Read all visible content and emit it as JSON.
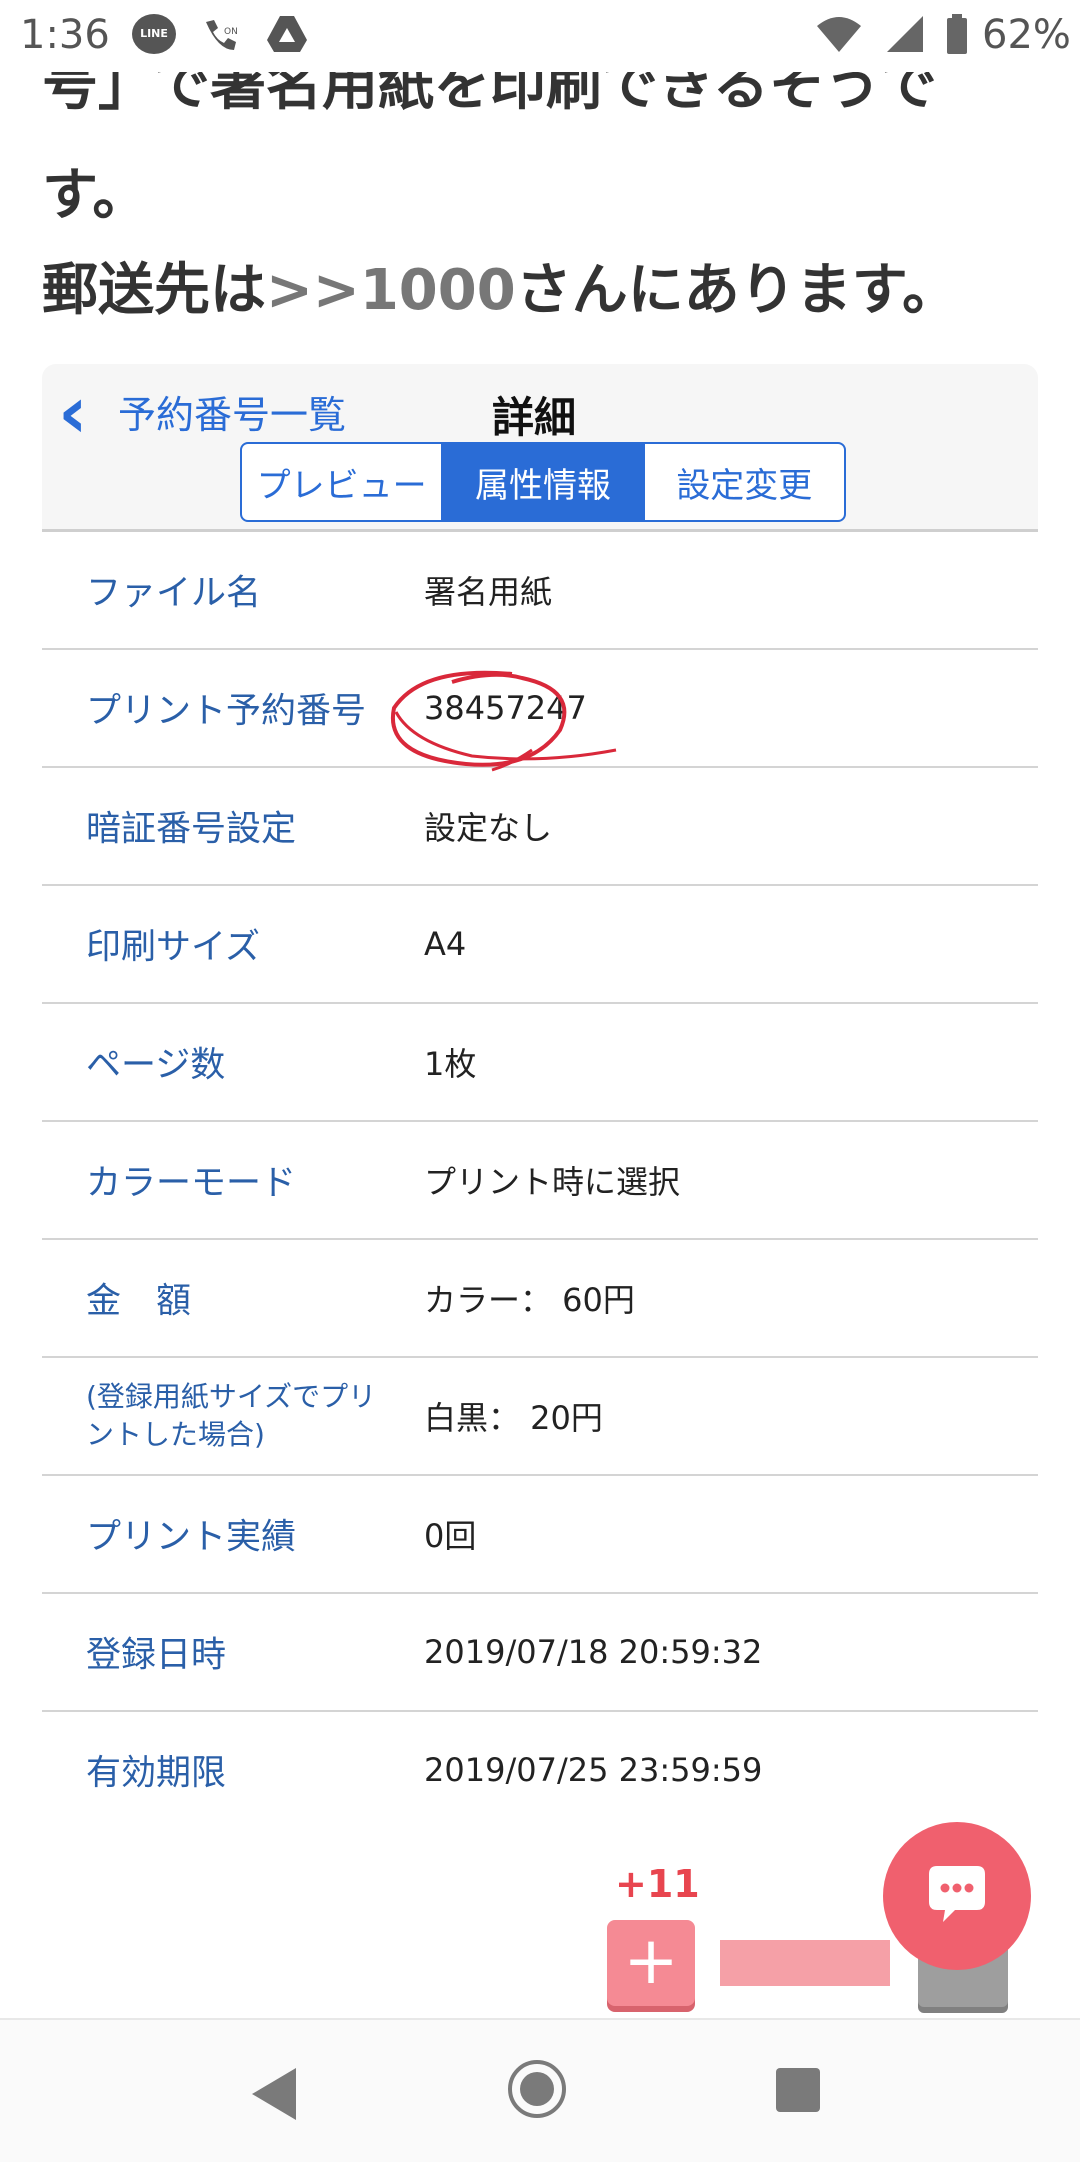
{
  "status_bar": {
    "time": "1:36",
    "battery": "62%",
    "line_icon_text": "LINE"
  },
  "article": {
    "line1": "号」で署名用紙を印刷できるそうで",
    "line2": "す。",
    "line3_prefix": "郵送先は",
    "line3_mention": ">>1000",
    "line3_suffix": "さんにあります。"
  },
  "detail_screen": {
    "back_label": "予約番号一覧",
    "title": "詳細",
    "tabs": [
      {
        "label": "プレビュー",
        "active": false
      },
      {
        "label": "属性情報",
        "active": true
      },
      {
        "label": "設定変更",
        "active": false
      }
    ],
    "rows": [
      {
        "label": "ファイル名",
        "value": "署名用紙"
      },
      {
        "label": "プリント予約番号",
        "value": "38457247"
      },
      {
        "label": "暗証番号設定",
        "value": "設定なし"
      },
      {
        "label": "印刷サイズ",
        "value": "A4"
      },
      {
        "label": "ページ数",
        "value": "1枚"
      },
      {
        "label": "カラーモード",
        "value": "プリント時に選択"
      },
      {
        "label": "金　額",
        "value": "カラー： 60円"
      },
      {
        "label": "(登録用紙サイズでプリントした場合)",
        "value": "白黒： 20円"
      },
      {
        "label": "プリント実績",
        "value": "0回"
      },
      {
        "label": "登録日時",
        "value": "2019/07/18 20:59:32"
      },
      {
        "label": "有効期限",
        "value": "2019/07/25 23:59:59"
      }
    ]
  },
  "overlay": {
    "plus_count": "+11",
    "plus_symbol": "+"
  },
  "colors": {
    "accent_blue": "#2a6cd6",
    "label_blue": "#2a5fa8",
    "fab_red": "#f0606e",
    "count_red": "#e8454f"
  }
}
